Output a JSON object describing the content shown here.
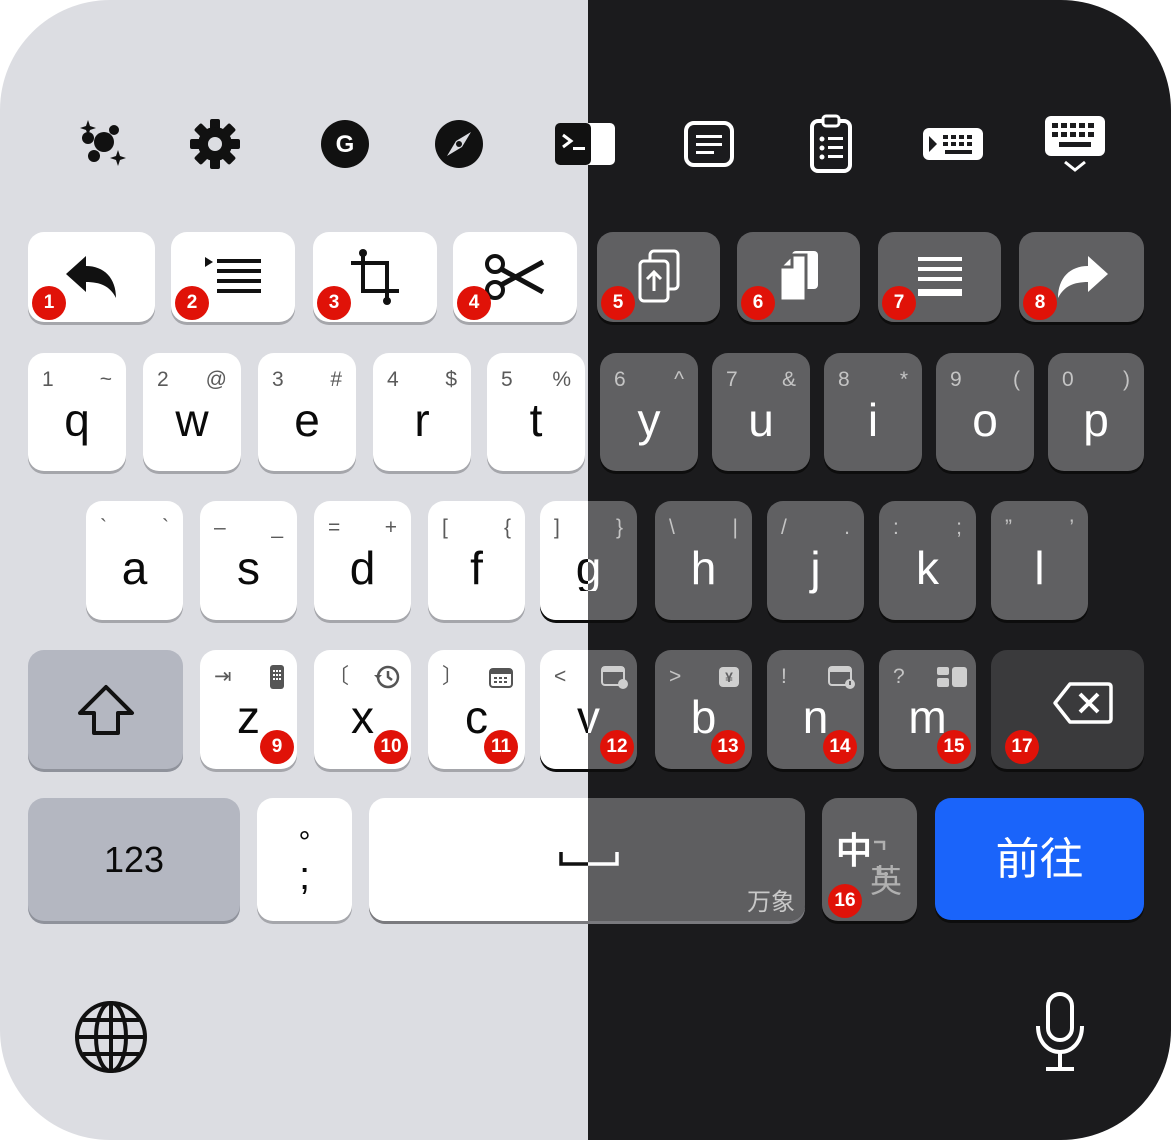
{
  "toolbar": {
    "icons": [
      "sparkles-icon",
      "gear-icon",
      "grammar-g-icon",
      "compass-icon",
      "terminal-icon",
      "note-icon",
      "clipboard-list-icon",
      "keyboard-type-icon",
      "keyboard-hide-icon"
    ]
  },
  "row1": [
    "1",
    "2",
    "3",
    "4",
    "5",
    "6",
    "7",
    "8"
  ],
  "qwerty": [
    {
      "key": "q",
      "num": "1",
      "sym": "~"
    },
    {
      "key": "w",
      "num": "2",
      "sym": "@"
    },
    {
      "key": "e",
      "num": "3",
      "sym": "#"
    },
    {
      "key": "r",
      "num": "4",
      "sym": "$"
    },
    {
      "key": "t",
      "num": "5",
      "sym": "%"
    },
    {
      "key": "y",
      "num": "6",
      "sym": "^"
    },
    {
      "key": "u",
      "num": "7",
      "sym": "&"
    },
    {
      "key": "i",
      "num": "8",
      "sym": "*"
    },
    {
      "key": "o",
      "num": "9",
      "sym": "("
    },
    {
      "key": "p",
      "num": "0",
      "sym": ")"
    }
  ],
  "asdf": [
    {
      "key": "a",
      "tl": "`",
      "tr": "`"
    },
    {
      "key": "s",
      "tl": "–",
      "tr": "_"
    },
    {
      "key": "d",
      "tl": "=",
      "tr": "+"
    },
    {
      "key": "f",
      "tl": "[",
      "tr": "{"
    },
    {
      "key": "g",
      "tl": "]",
      "tr": "}"
    },
    {
      "key": "h",
      "tl": "\\",
      "tr": "|"
    },
    {
      "key": "j",
      "tl": "/",
      "tr": "."
    },
    {
      "key": "k",
      "tl": ":",
      "tr": ";"
    },
    {
      "key": "l",
      "tl": "”",
      "tr": "’"
    }
  ],
  "zxcv": [
    {
      "key": "z",
      "tl": "⇥",
      "badge": "9"
    },
    {
      "key": "x",
      "tl": "〔",
      "badge": "10"
    },
    {
      "key": "c",
      "tl": "〕",
      "badge": "11"
    },
    {
      "key": "v",
      "tl": "<",
      "badge": "12"
    },
    {
      "key": "b",
      "tl": ">",
      "badge": "13"
    },
    {
      "key": "n",
      "tl": "!",
      "badge": "14"
    },
    {
      "key": "m",
      "tl": "?",
      "badge": "15"
    }
  ],
  "bottom": {
    "num_label": "123",
    "semicolon_top": "°",
    "semicolon": ";",
    "space_hint": "万象",
    "lang_zh": "中",
    "lang_en": "英",
    "lang_badge": "16",
    "go_label": "前往",
    "go_color": "#1a64fa",
    "backspace_badge": "17"
  }
}
